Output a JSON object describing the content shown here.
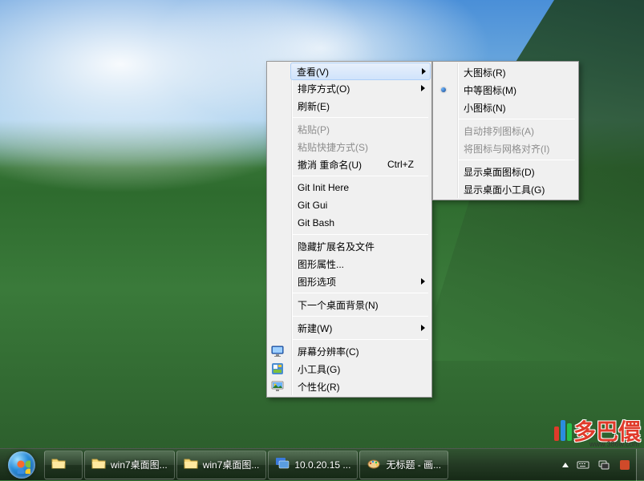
{
  "context_menu": {
    "groups": [
      [
        {
          "key": "view",
          "label": "查看(V)",
          "submenu": true,
          "highlighted": true
        },
        {
          "key": "sort",
          "label": "排序方式(O)",
          "submenu": true
        },
        {
          "key": "refresh",
          "label": "刷新(E)"
        }
      ],
      [
        {
          "key": "paste",
          "label": "粘贴(P)",
          "disabled": true
        },
        {
          "key": "paste-shortcut",
          "label": "粘贴快捷方式(S)",
          "disabled": true
        },
        {
          "key": "undo-rename",
          "label": "撤消 重命名(U)",
          "shortcut": "Ctrl+Z"
        }
      ],
      [
        {
          "key": "git-init",
          "label": "Git Init Here"
        },
        {
          "key": "git-gui",
          "label": "Git Gui"
        },
        {
          "key": "git-bash",
          "label": "Git Bash"
        }
      ],
      [
        {
          "key": "hide-ext",
          "label": "隐藏扩展名及文件"
        },
        {
          "key": "graphic-props",
          "label": "图形属性..."
        },
        {
          "key": "graphic-opts",
          "label": "图形选项",
          "submenu": true
        }
      ],
      [
        {
          "key": "next-bg",
          "label": "下一个桌面背景(N)"
        }
      ],
      [
        {
          "key": "new",
          "label": "新建(W)",
          "submenu": true
        }
      ],
      [
        {
          "key": "resolution",
          "label": "屏幕分辨率(C)",
          "icon": "monitor"
        },
        {
          "key": "gadgets",
          "label": "小工具(G)",
          "icon": "gadget"
        },
        {
          "key": "personalize",
          "label": "个性化(R)",
          "icon": "personalize"
        }
      ]
    ]
  },
  "submenu_view": {
    "groups": [
      [
        {
          "key": "large-icons",
          "label": "大图标(R)"
        },
        {
          "key": "medium-icons",
          "label": "中等图标(M)",
          "selected": true
        },
        {
          "key": "small-icons",
          "label": "小图标(N)"
        }
      ],
      [
        {
          "key": "auto-arrange",
          "label": "自动排列图标(A)",
          "disabled": true
        },
        {
          "key": "align-grid",
          "label": "将图标与网格对齐(I)",
          "disabled": true
        }
      ],
      [
        {
          "key": "show-icons",
          "label": "显示桌面图标(D)"
        },
        {
          "key": "show-gadgets",
          "label": "显示桌面小工具(G)"
        }
      ]
    ]
  },
  "taskbar": {
    "buttons": [
      {
        "key": "explorer",
        "label": "",
        "icon": "folder"
      },
      {
        "key": "folder1",
        "label": "win7桌面图...",
        "icon": "folder"
      },
      {
        "key": "folder2",
        "label": "win7桌面图...",
        "icon": "folder"
      },
      {
        "key": "remote",
        "label": "10.0.20.15 ...",
        "icon": "remote"
      },
      {
        "key": "paint",
        "label": "无标题 - 画...",
        "icon": "paint"
      }
    ],
    "tray": [
      {
        "key": "expand",
        "name": "tray-expand-icon"
      },
      {
        "key": "keyboard",
        "name": "keyboard-icon"
      },
      {
        "key": "network",
        "name": "network-icon"
      },
      {
        "key": "app1",
        "name": "app-icon"
      }
    ]
  },
  "watermark": {
    "text": "多巴儇",
    "url": "www.386w.com"
  }
}
